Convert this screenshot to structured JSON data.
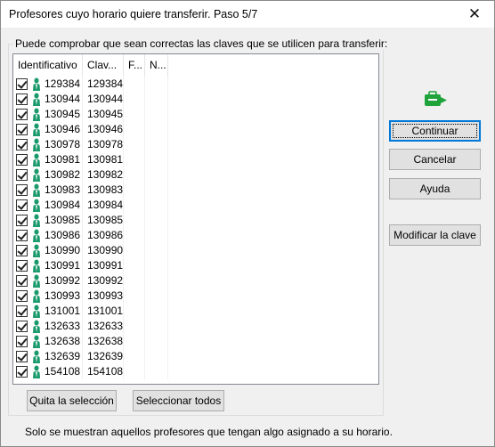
{
  "window": {
    "title": "Profesores cuyo horario quiere transferir. Paso 5/7",
    "close_glyph": "✕"
  },
  "group": {
    "legend": "Puede comprobar que sean correctas las claves que se utilicen para transferir:"
  },
  "list": {
    "columns": [
      "Identificativo",
      "Clav...",
      "F...",
      "N..."
    ],
    "rows": [
      {
        "id": "129384",
        "clave": "129384",
        "checked": true
      },
      {
        "id": "130944",
        "clave": "130944",
        "checked": true
      },
      {
        "id": "130945",
        "clave": "130945",
        "checked": true
      },
      {
        "id": "130946",
        "clave": "130946",
        "checked": true
      },
      {
        "id": "130978",
        "clave": "130978",
        "checked": true
      },
      {
        "id": "130981",
        "clave": "130981",
        "checked": true
      },
      {
        "id": "130982",
        "clave": "130982",
        "checked": true
      },
      {
        "id": "130983",
        "clave": "130983",
        "checked": true
      },
      {
        "id": "130984",
        "clave": "130984",
        "checked": true
      },
      {
        "id": "130985",
        "clave": "130985",
        "checked": true
      },
      {
        "id": "130986",
        "clave": "130986",
        "checked": true
      },
      {
        "id": "130990",
        "clave": "130990",
        "checked": true
      },
      {
        "id": "130991",
        "clave": "130991",
        "checked": true
      },
      {
        "id": "130992",
        "clave": "130992",
        "checked": true
      },
      {
        "id": "130993",
        "clave": "130993",
        "checked": true
      },
      {
        "id": "131001",
        "clave": "131001",
        "checked": true
      },
      {
        "id": "132633",
        "clave": "132633",
        "checked": true
      },
      {
        "id": "132638",
        "clave": "132638",
        "checked": true
      },
      {
        "id": "132639",
        "clave": "132639",
        "checked": true
      },
      {
        "id": "154108",
        "clave": "154108",
        "checked": true
      }
    ]
  },
  "buttons": {
    "continuar": "Continuar",
    "cancelar": "Cancelar",
    "ayuda": "Ayuda",
    "modificar": "Modificar la clave",
    "quita": "Quita la selección",
    "seleccionar": "Seleccionar todos"
  },
  "footer": {
    "note": "Solo se muestran aquellos profesores que tengan algo asignado a su horario."
  },
  "colors": {
    "accent": "#0078d7",
    "person_icon": "#1a9a6c",
    "app_icon": "#1fa33a"
  }
}
